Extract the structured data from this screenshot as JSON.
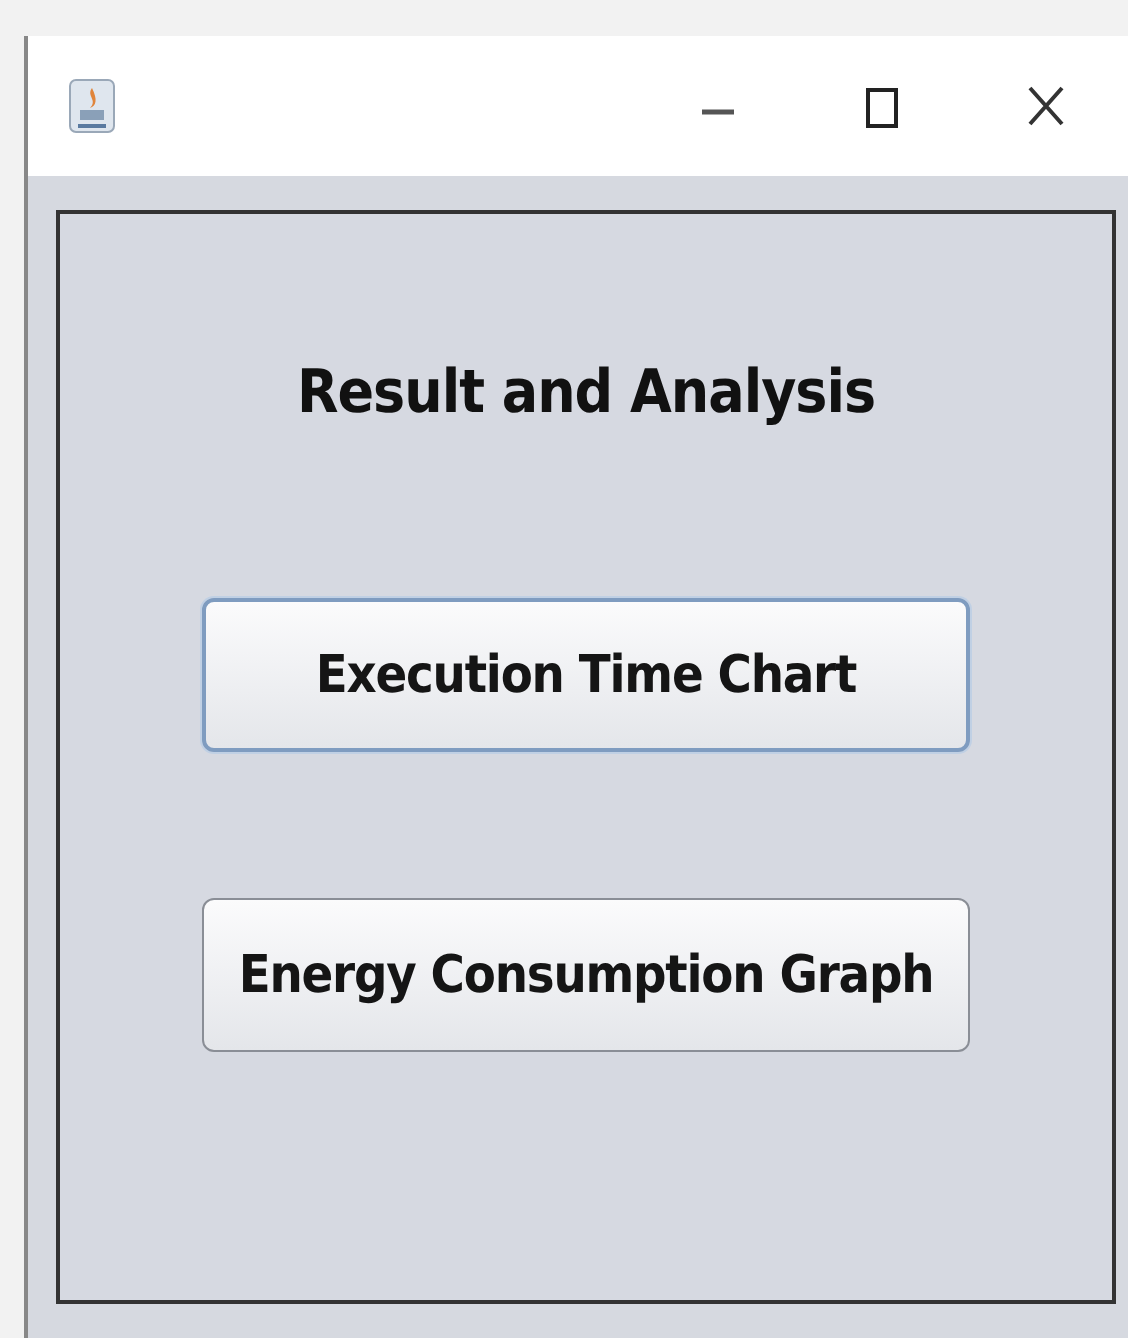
{
  "window": {
    "title_bar": {
      "controls": [
        {
          "kind": "minimize"
        },
        {
          "kind": "maximize"
        },
        {
          "kind": "close"
        }
      ]
    }
  },
  "heading": "Result and Analysis",
  "buttons": [
    {
      "label": "Execution Time Chart",
      "focused": true
    },
    {
      "label": "Energy Consumption Graph",
      "focused": false
    }
  ]
}
